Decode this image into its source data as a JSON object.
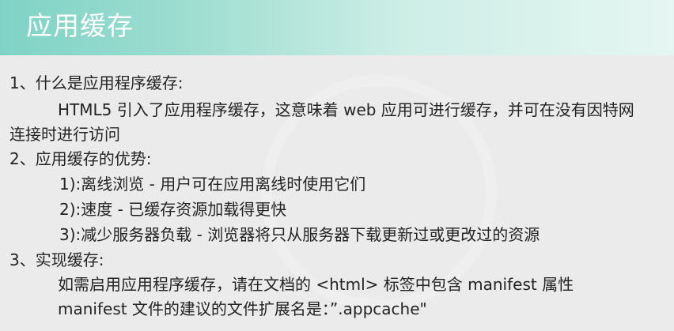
{
  "header": {
    "title": "应用缓存"
  },
  "sections": {
    "s1_heading": "1、什么是应用程序缓存:",
    "s1_body_1": "HTML5 引入了应用程序缓存，这意味着 web 应用可进行缓存，并可在没有因特网",
    "s1_body_2": "连接时进行访问",
    "s2_heading": "2、应用缓存的优势:",
    "s2_item_1": "1):离线浏览 - 用户可在应用离线时使用它们",
    "s2_item_2": "2):速度 - 已缓存资源加载得更快",
    "s2_item_3": "3):减少服务器负载 - 浏览器将只从服务器下载更新过或更改过的资源",
    "s3_heading": "3、实现缓存:",
    "s3_body_1": "如需启用应用程序缓存，请在文档的 <html> 标签中包含 manifest 属性",
    "s3_body_2": "manifest 文件的建议的文件扩展名是：”.appcache\""
  },
  "colors": {
    "header_accent": "#7fd3c6",
    "header_title": "#ffffff",
    "background": "#ebebeb",
    "text": "#232323"
  }
}
